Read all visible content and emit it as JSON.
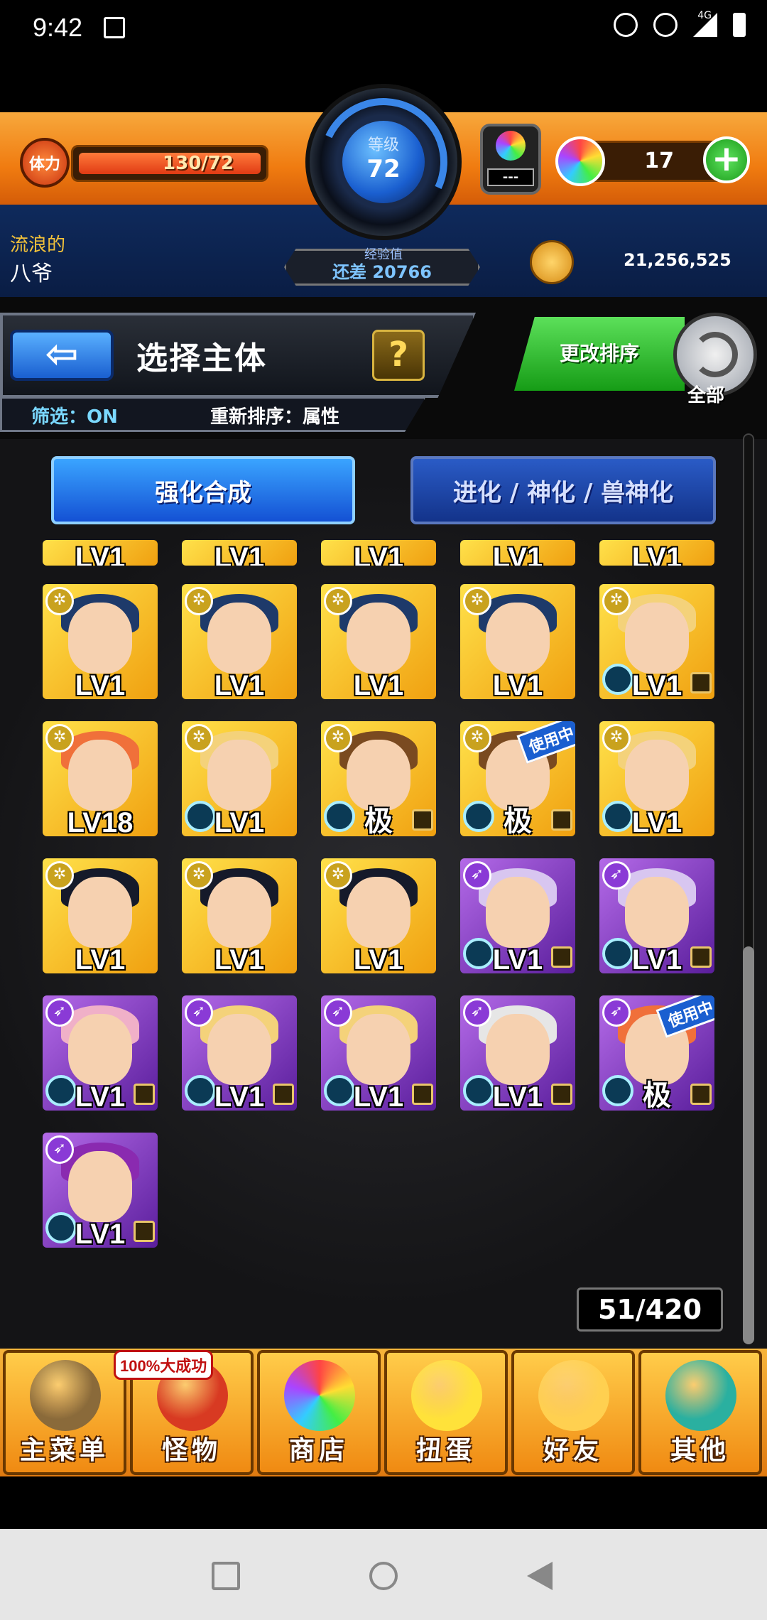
{
  "status_bar": {
    "time": "9:42",
    "network": "4G"
  },
  "header": {
    "stamina_label": "体力",
    "stamina_value": "130/72",
    "level_label": "等级",
    "level_value": "72",
    "ticket_text": "---",
    "orb_count": "17",
    "exp_label": "经验值",
    "exp_remaining": "还差 20766",
    "gold": "21,256,525"
  },
  "player": {
    "title": "流浪的",
    "name": "八爷"
  },
  "panel": {
    "title": "选择主体",
    "help": "?",
    "filter": "筛选：ON",
    "sort": "重新排序：属性",
    "change_sort": "更改排序",
    "all": "全部"
  },
  "tabs": [
    {
      "label": "强化合成",
      "active": true
    },
    {
      "label": "进化 / 神化 / 兽神化",
      "active": false
    }
  ],
  "monsters": [
    {
      "lv": "LV1",
      "bg": "yellow",
      "hair": "blue",
      "el": "light",
      "lock": false,
      "eff": false
    },
    {
      "lv": "LV1",
      "bg": "yellow",
      "hair": "blue",
      "el": "light",
      "lock": false,
      "eff": false
    },
    {
      "lv": "LV1",
      "bg": "yellow",
      "hair": "blue",
      "el": "light",
      "lock": false,
      "eff": false
    },
    {
      "lv": "LV1",
      "bg": "yellow",
      "hair": "blue",
      "el": "light",
      "lock": false,
      "eff": false
    },
    {
      "lv": "LV1",
      "bg": "yellow",
      "hair": "blonde",
      "el": "light",
      "lock": true,
      "eff": true
    },
    {
      "lv": "LV18",
      "bg": "yellow",
      "hair": "orange",
      "el": "light",
      "lock": false,
      "eff": false
    },
    {
      "lv": "LV1",
      "bg": "yellow",
      "hair": "blonde",
      "el": "light",
      "lock": false,
      "eff": true
    },
    {
      "lv": "极",
      "bg": "yellow",
      "hair": "brown",
      "el": "light",
      "lock": true,
      "eff": true
    },
    {
      "lv": "极",
      "bg": "yellow",
      "hair": "brown",
      "el": "light",
      "lock": true,
      "eff": true,
      "inuse": "使用中"
    },
    {
      "lv": "LV1",
      "bg": "yellow",
      "hair": "blonde",
      "el": "light",
      "lock": false,
      "eff": true
    },
    {
      "lv": "LV1",
      "bg": "yellow",
      "hair": "black",
      "el": "light",
      "lock": false,
      "eff": false
    },
    {
      "lv": "LV1",
      "bg": "yellow",
      "hair": "black",
      "el": "light",
      "lock": false,
      "eff": false
    },
    {
      "lv": "LV1",
      "bg": "yellow",
      "hair": "black",
      "el": "light",
      "lock": false,
      "eff": false
    },
    {
      "lv": "LV1",
      "bg": "purple",
      "hair": "lilac",
      "el": "dark",
      "lock": true,
      "eff": true
    },
    {
      "lv": "LV1",
      "bg": "purple",
      "hair": "lilac",
      "el": "dark",
      "lock": true,
      "eff": true
    },
    {
      "lv": "LV1",
      "bg": "purple",
      "hair": "pink",
      "el": "dark",
      "lock": true,
      "eff": true
    },
    {
      "lv": "LV1",
      "bg": "purple",
      "hair": "blonde",
      "el": "dark",
      "lock": true,
      "eff": true
    },
    {
      "lv": "LV1",
      "bg": "purple",
      "hair": "blonde",
      "el": "dark",
      "lock": true,
      "eff": true
    },
    {
      "lv": "LV1",
      "bg": "purple",
      "hair": "silver",
      "el": "dark",
      "lock": true,
      "eff": true
    },
    {
      "lv": "极",
      "bg": "purple",
      "hair": "orange",
      "el": "dark",
      "lock": true,
      "eff": true,
      "inuse": "使用中"
    },
    {
      "lv": "LV1",
      "bg": "purple",
      "hair": "violet",
      "el": "dark",
      "lock": true,
      "eff": true
    }
  ],
  "top_row_partial": [
    "LV1",
    "LV1",
    "LV1",
    "LV1",
    "LV1"
  ],
  "box_count": "51/420",
  "bottom_nav": [
    {
      "label": "主菜单",
      "icon": "gate-icon",
      "color": "#8a6a3a"
    },
    {
      "label": "怪物",
      "icon": "dragon-icon",
      "color": "#d83a22",
      "badge": "100%大成功"
    },
    {
      "label": "商店",
      "icon": "orb-icon",
      "color": "#6ab0ff"
    },
    {
      "label": "扭蛋",
      "icon": "egg-icon",
      "color": "#ffe23a"
    },
    {
      "label": "好友",
      "icon": "balloons-icon",
      "color": "#ffd050"
    },
    {
      "label": "其他",
      "icon": "question-icon",
      "color": "#2ab0a0"
    }
  ]
}
